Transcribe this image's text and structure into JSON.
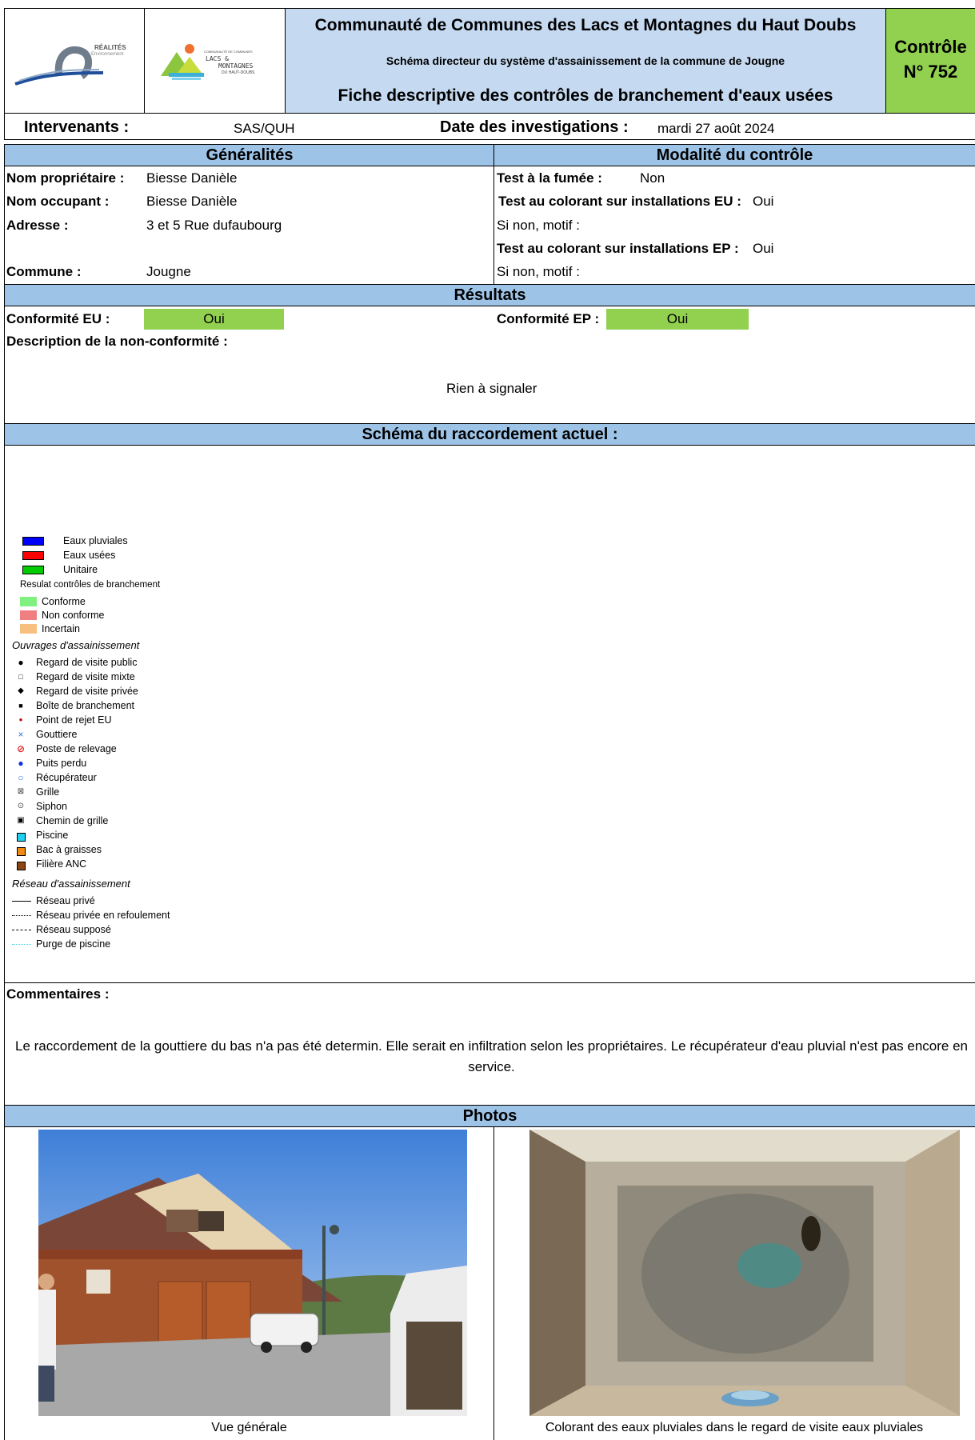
{
  "header": {
    "logo1_text": "RÉALITÉS",
    "logo1_sub": "Environnement",
    "logo2_line0": "COMMUNAUTÉ DE COMMUNES",
    "logo2_line1": "LACS &",
    "logo2_line2": "MONTAGNES",
    "logo2_line3": "DU HAUT-DOUBS",
    "title": "Communauté de Communes des Lacs et Montagnes du Haut Doubs",
    "subtitle": "Schéma directeur du système d'assainissement de la commune de Jougne",
    "doc_title": "Fiche descriptive des contrôles de branchement d'eaux usées",
    "control_label": "Contrôle",
    "control_number": "N° 752"
  },
  "investigation": {
    "intervenants_label": "Intervenants :",
    "intervenants_value": "SAS/QUH",
    "date_label": "Date des investigations :",
    "date_value": "mardi 27 août 2024"
  },
  "generalites": {
    "heading": "Généralités",
    "owner_label": "Nom propriétaire :",
    "owner_value": "Biesse Danièle",
    "occupant_label": "Nom occupant :",
    "occupant_value": "Biesse Danièle",
    "address_label": "Adresse :",
    "address_value": "3 et 5 Rue dufaubourg",
    "commune_label": "Commune :",
    "commune_value": "Jougne"
  },
  "modalite": {
    "heading": "Modalité du contrôle",
    "smoke_label": "Test à la fumée :",
    "smoke_value": "Non",
    "dye_eu_label": "Test au colorant sur installations EU :",
    "dye_eu_value": "Oui",
    "reason1_label": "Si non, motif :",
    "dye_ep_label": "Test au colorant sur installations EP :",
    "dye_ep_value": "Oui",
    "reason2_label": "Si non, motif :"
  },
  "resultats": {
    "heading": "Résultats",
    "eu_label": "Conformité EU :",
    "eu_value": "Oui",
    "ep_label": "Conformité EP :",
    "ep_value": "Oui",
    "desc_label": "Description de la non-conformité :",
    "desc_value": "Rien à signaler"
  },
  "schema": {
    "heading": "Schéma du raccordement actuel :",
    "legend": {
      "water_types": [
        {
          "label": "Eaux pluviales",
          "color": "#0000ff"
        },
        {
          "label": "Eaux usées",
          "color": "#ff0000"
        },
        {
          "label": "Unitaire",
          "color": "#00cc00"
        }
      ],
      "results_title": "Resulat contrôles de branchement",
      "results": [
        {
          "label": "Conforme",
          "color": "#80f080"
        },
        {
          "label": "Non conforme",
          "color": "#f08080"
        },
        {
          "label": "Incertain",
          "color": "#f8c080"
        }
      ],
      "ouvrages_title": "Ouvrages d'assainissement",
      "ouvrages": [
        {
          "label": "Regard de visite public",
          "icon": "filled-circle-icon"
        },
        {
          "label": "Regard de visite mixte",
          "icon": "hollow-square-icon"
        },
        {
          "label": "Regard de visite privée",
          "icon": "diamond-icon"
        },
        {
          "label": "Boîte de branchement",
          "icon": "filled-square-icon"
        },
        {
          "label": "Point de rejet EU",
          "icon": "red-dot-icon"
        },
        {
          "label": "Gouttiere",
          "icon": "cross-icon"
        },
        {
          "label": "Poste de relevage",
          "icon": "prohibited-circle-icon"
        },
        {
          "label": "Puits perdu",
          "icon": "blue-circle-icon"
        },
        {
          "label": "Récupérateur",
          "icon": "blue-ring-icon"
        },
        {
          "label": "Grille",
          "icon": "boxed-x-icon"
        },
        {
          "label": "Siphon",
          "icon": "circled-dot-icon"
        },
        {
          "label": "Chemin de grille",
          "icon": "boxed-dot-icon"
        },
        {
          "label": "Piscine",
          "icon": "cyan-square-icon"
        },
        {
          "label": "Bac à graisses",
          "icon": "orange-square-icon"
        },
        {
          "label": "Filière ANC",
          "icon": "brown-square-icon"
        }
      ],
      "reseau_title": "Réseau d'assainissement",
      "reseau": [
        {
          "label": "Réseau privé",
          "icon": "solid-line-icon"
        },
        {
          "label": "Réseau privée en refoulement",
          "icon": "dotted-line-icon"
        },
        {
          "label": "Réseau supposé",
          "icon": "dashed-line-icon"
        },
        {
          "label": "Purge de piscine",
          "icon": "cyan-dotted-line-icon"
        }
      ]
    }
  },
  "commentaires": {
    "label": "Commentaires :",
    "text": "Le raccordement de la gouttiere du bas n'a pas été determin. Elle serait en infiltration selon les propriétaires. Le récupérateur d'eau pluvial n'est pas encore en service."
  },
  "photos": {
    "heading": "Photos",
    "caption1": "Vue générale",
    "caption2": "Colorant des eaux pluviales dans le regard de visite eaux pluviales"
  },
  "colors": {
    "band_blue": "#9dc3e6",
    "header_blue": "#c5d9f1",
    "green": "#92d050"
  }
}
